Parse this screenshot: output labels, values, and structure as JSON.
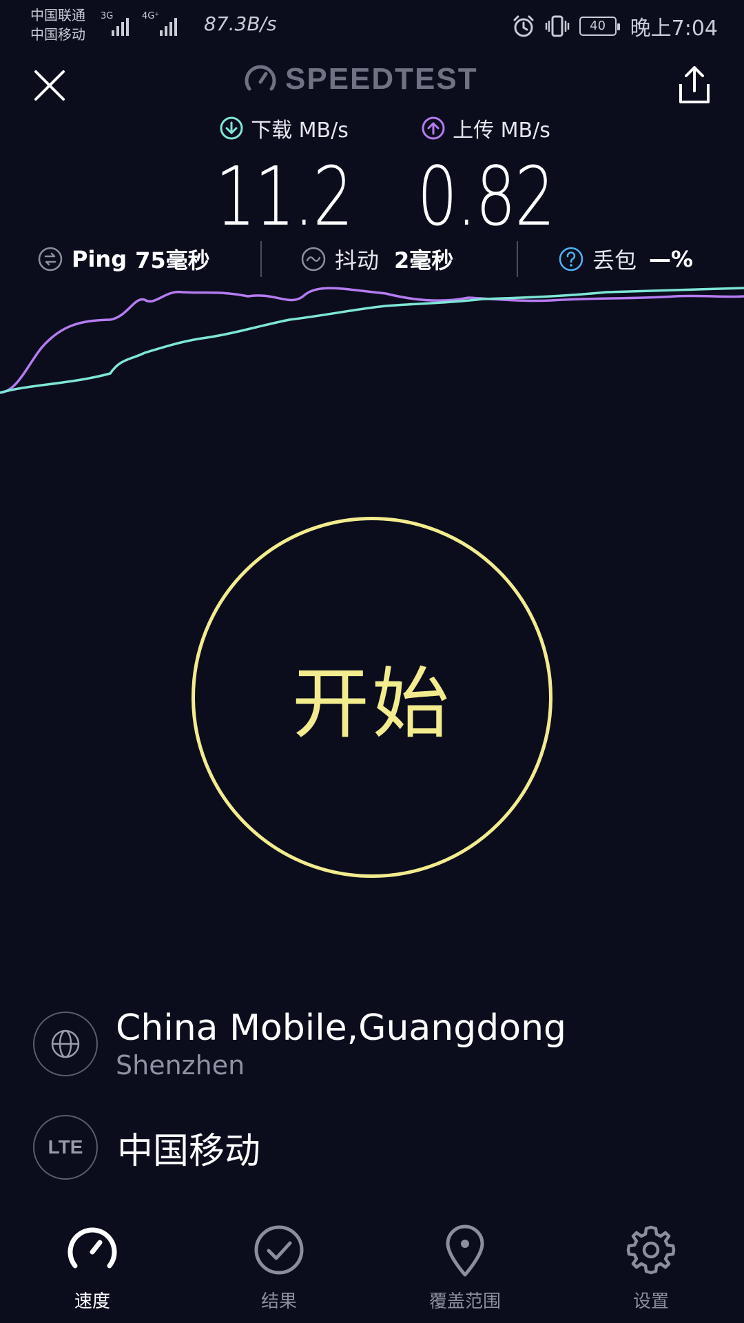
{
  "status_bar": {
    "carrier_1": "中国联通",
    "carrier_2": "中国移动",
    "net_badge_1": "3G",
    "net_badge_2": "4G⁺",
    "net_speed": "87.3B/s",
    "battery": "40",
    "time": "晚上7:04"
  },
  "header": {
    "brand": "SPEEDTEST"
  },
  "results": {
    "download_label": "下载 MB/s",
    "download_value": "11.2",
    "upload_label": "上传 MB/s",
    "upload_value": "0.82"
  },
  "metrics": {
    "ping_label": "Ping",
    "ping_value": "75毫秒",
    "jitter_label": "抖动",
    "jitter_value": "2毫秒",
    "loss_label": "丢包",
    "loss_value": "—%"
  },
  "colors": {
    "download": "#7ee6d6",
    "upload": "#b57cf0",
    "start": "#f3ec8f",
    "background": "#0b0d1d"
  },
  "start_button": {
    "label": "开始"
  },
  "server": {
    "name": "China Mobile,Guangdong",
    "city": "Shenzhen"
  },
  "provider": {
    "badge": "LTE",
    "name": "中国移动"
  },
  "nav": {
    "items": [
      {
        "label": "速度",
        "icon": "speedometer-icon",
        "active": true
      },
      {
        "label": "结果",
        "icon": "check-circle-icon",
        "active": false
      },
      {
        "label": "覆盖范围",
        "icon": "map-pin-icon",
        "active": false
      },
      {
        "label": "设置",
        "icon": "gear-icon",
        "active": false
      }
    ]
  }
}
